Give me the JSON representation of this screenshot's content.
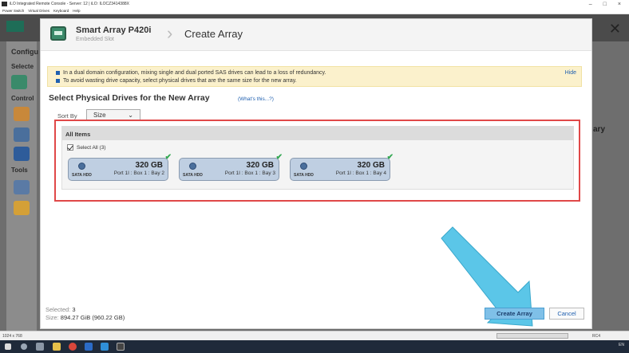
{
  "window": {
    "title": "iLO Integrated Remote Console - Server: 12 | iLO: ILOCZ3414388X",
    "controls": [
      "–",
      "□",
      "×"
    ]
  },
  "menu": [
    "Power Switch",
    "Virtual Drives",
    "Keyboard",
    "Help"
  ],
  "background": {
    "left_labels": [
      "Configu",
      "Selecte",
      "Control",
      "Tools"
    ],
    "right_label": "ary"
  },
  "dialog": {
    "controller_name": "Smart Array P420i",
    "controller_slot": "Embedded Slot",
    "title": "Create Array",
    "warnings": [
      "In a dual domain configuration, mixing single and dual ported SAS drives can lead to a loss of redundancy.",
      "To avoid wasting drive capacity, select physical drives that are the same size for the new array."
    ],
    "hide_label": "Hide",
    "section_title": "Select Physical Drives for the New Array",
    "whats_this": "(What's this...?)",
    "sort_by_label": "Sort By",
    "sort_by_value": "Size",
    "items_header": "All Items",
    "select_all": "Select All (3)",
    "drives": [
      {
        "type": "SATA HDD",
        "capacity": "320 GB",
        "location": "Port 1I : Box 1 : Bay 2"
      },
      {
        "type": "SATA HDD",
        "capacity": "320 GB",
        "location": "Port 1I : Box 1 : Bay 3"
      },
      {
        "type": "SATA HDD",
        "capacity": "320 GB",
        "location": "Port 1I : Box 1 : Bay 4"
      }
    ],
    "footer": {
      "selected_label": "Selected:",
      "selected_value": "3",
      "size_label": "Size:",
      "size_value": "894.27 GiB (960.22 GB)"
    },
    "create_button": "Create Array",
    "cancel_button": "Cancel"
  },
  "status": {
    "resolution": "1024 x 768",
    "protocol": "RC4"
  },
  "taskbar": {
    "clock": "EN"
  },
  "colors": {
    "highlight_border": "#e04848",
    "drive_fill": "#bfcfe2",
    "primary_button": "#7fc0e8",
    "arrow": "#5bc6e8",
    "warning_bg": "#fbf1cc"
  }
}
